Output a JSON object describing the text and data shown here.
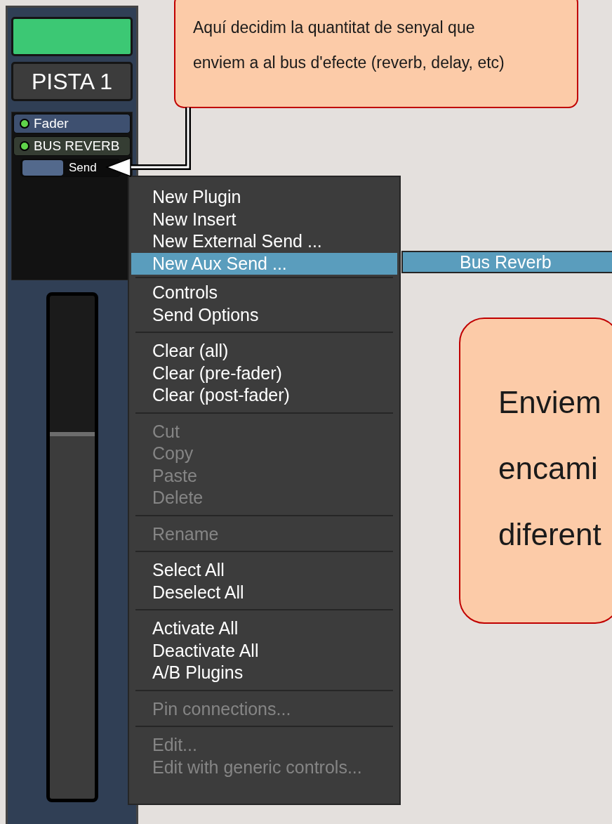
{
  "mixer_strip": {
    "name_button": "PISTA 1",
    "processors": [
      {
        "kind": "fader",
        "label": "Fader",
        "active": true
      },
      {
        "kind": "insert",
        "label": "BUS REVERB",
        "active": true
      },
      {
        "kind": "send",
        "label": "Send"
      }
    ],
    "fader": {
      "level": 0.72
    }
  },
  "context_menu": {
    "groups": [
      [
        {
          "label": "New Plugin",
          "disabled": false,
          "selected": false
        },
        {
          "label": "New Insert",
          "disabled": false,
          "selected": false
        },
        {
          "label": "New External Send ...",
          "disabled": false,
          "selected": false
        },
        {
          "label": "New Aux Send ...",
          "disabled": false,
          "selected": true
        }
      ],
      [
        {
          "label": "Controls",
          "disabled": false,
          "selected": false
        },
        {
          "label": "Send Options",
          "disabled": false,
          "selected": false
        }
      ],
      [
        {
          "label": "Clear (all)",
          "disabled": false,
          "selected": false
        },
        {
          "label": "Clear (pre-fader)",
          "disabled": false,
          "selected": false
        },
        {
          "label": "Clear (post-fader)",
          "disabled": false,
          "selected": false
        }
      ],
      [
        {
          "label": "Cut",
          "disabled": true,
          "selected": false
        },
        {
          "label": "Copy",
          "disabled": true,
          "selected": false
        },
        {
          "label": "Paste",
          "disabled": true,
          "selected": false
        },
        {
          "label": "Delete",
          "disabled": true,
          "selected": false
        }
      ],
      [
        {
          "label": "Rename",
          "disabled": true,
          "selected": false
        }
      ],
      [
        {
          "label": "Select All",
          "disabled": false,
          "selected": false
        },
        {
          "label": "Deselect All",
          "disabled": false,
          "selected": false
        }
      ],
      [
        {
          "label": "Activate All",
          "disabled": false,
          "selected": false
        },
        {
          "label": "Deactivate All",
          "disabled": false,
          "selected": false
        },
        {
          "label": "A/B Plugins",
          "disabled": false,
          "selected": false
        }
      ],
      [
        {
          "label": "Pin connections...",
          "disabled": true,
          "selected": false
        }
      ],
      [
        {
          "label": "Edit...",
          "disabled": true,
          "selected": false
        },
        {
          "label": "Edit with generic controls...",
          "disabled": true,
          "selected": false
        }
      ]
    ],
    "submenu": [
      {
        "label": "Bus Reverb",
        "selected": true
      }
    ]
  },
  "callouts": [
    {
      "lines": [
        "Aquí decidim la quantitat de senyal que",
        "enviem a al bus d'efecte (reverb, delay, etc)"
      ]
    },
    {
      "lines": [
        "Enviem",
        "encami",
        "diferent"
      ]
    }
  ]
}
